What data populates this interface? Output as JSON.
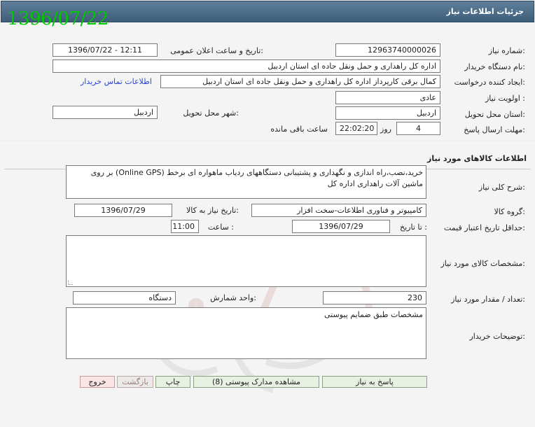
{
  "header": {
    "title": "جزئیات اطلاعات نیاز",
    "date_stamp": "1396/07/22"
  },
  "form": {
    "need_number": {
      "label": "شماره نیاز:",
      "value": "12963740000026"
    },
    "announce": {
      "label": "تاریخ و ساعت اعلان عمومی:",
      "value": "1396/07/22 - 12:11"
    },
    "buyer": {
      "label": "نام دستگاه خریدار:",
      "value": "اداره کل راهداری و حمل ونقل جاده ای استان اردبیل"
    },
    "creator": {
      "label": "ایجاد کننده درخواست:",
      "value": "کمال برقی کارپرداز اداره کل راهداری و حمل ونقل جاده ای استان اردبیل",
      "contact_link": "اطلاعات تماس خریدار"
    },
    "priority": {
      "label": "اولویت نیاز :",
      "value": "عادی"
    },
    "province": {
      "label": "استان محل تحویل:",
      "value": "اردبیل"
    },
    "city": {
      "label": "شهر محل تحویل:",
      "value": "اردبیل"
    },
    "deadline": {
      "label": "مهلت ارسال پاسخ:",
      "days": "4",
      "day_word": "روز و",
      "time": "22:02:20",
      "remaining": "ساعت باقی مانده"
    }
  },
  "goods": {
    "section_title": "اطلاعات کالاهای مورد نیاز",
    "summary": {
      "label": "شرح کلی نیاز:",
      "value": "خرید،نصب،راه اندازی و نگهداری و پشتیبانی دستگاههای ردیاب ماهواره ای برخط (Online GPS) بر روی ماشین آلات راهداری اداره کل"
    },
    "group": {
      "label": "گروه کالا:",
      "value": "کامپیوتر و فناوری اطلاعات-سخت افزار"
    },
    "need_date": {
      "label": "تاریخ نیاز به کالا:",
      "value": "1396/07/29"
    },
    "price_validity": {
      "label": "حداقل تاریخ اعتبار قیمت:",
      "to_label": "تا تاریخ :",
      "date": "1396/07/29",
      "time_label": "ساعت :",
      "time": "11:00"
    },
    "specs": {
      "label": "مشخصات کالای مورد نیاز:",
      "value": ""
    },
    "quantity": {
      "label": "تعداد / مقدار مورد نیاز:",
      "value": "230",
      "unit_label": "واحد شمارش:",
      "unit": "دستگاه"
    },
    "buyer_notes": {
      "label": "توضیحات خریدار:",
      "value": "مشخصات طبق ضمایم پیوستی"
    }
  },
  "buttons": {
    "reply": "پاسخ به نیاز",
    "attachments": "مشاهده مدارک پیوستی (8)",
    "print": "چاپ",
    "back": "بازگشت",
    "exit": "خروج"
  },
  "colors": {
    "header": "#4a6a86",
    "date_stamp": "#00c800",
    "link": "#2b45d6",
    "button_bg": "#e8f0e4"
  }
}
